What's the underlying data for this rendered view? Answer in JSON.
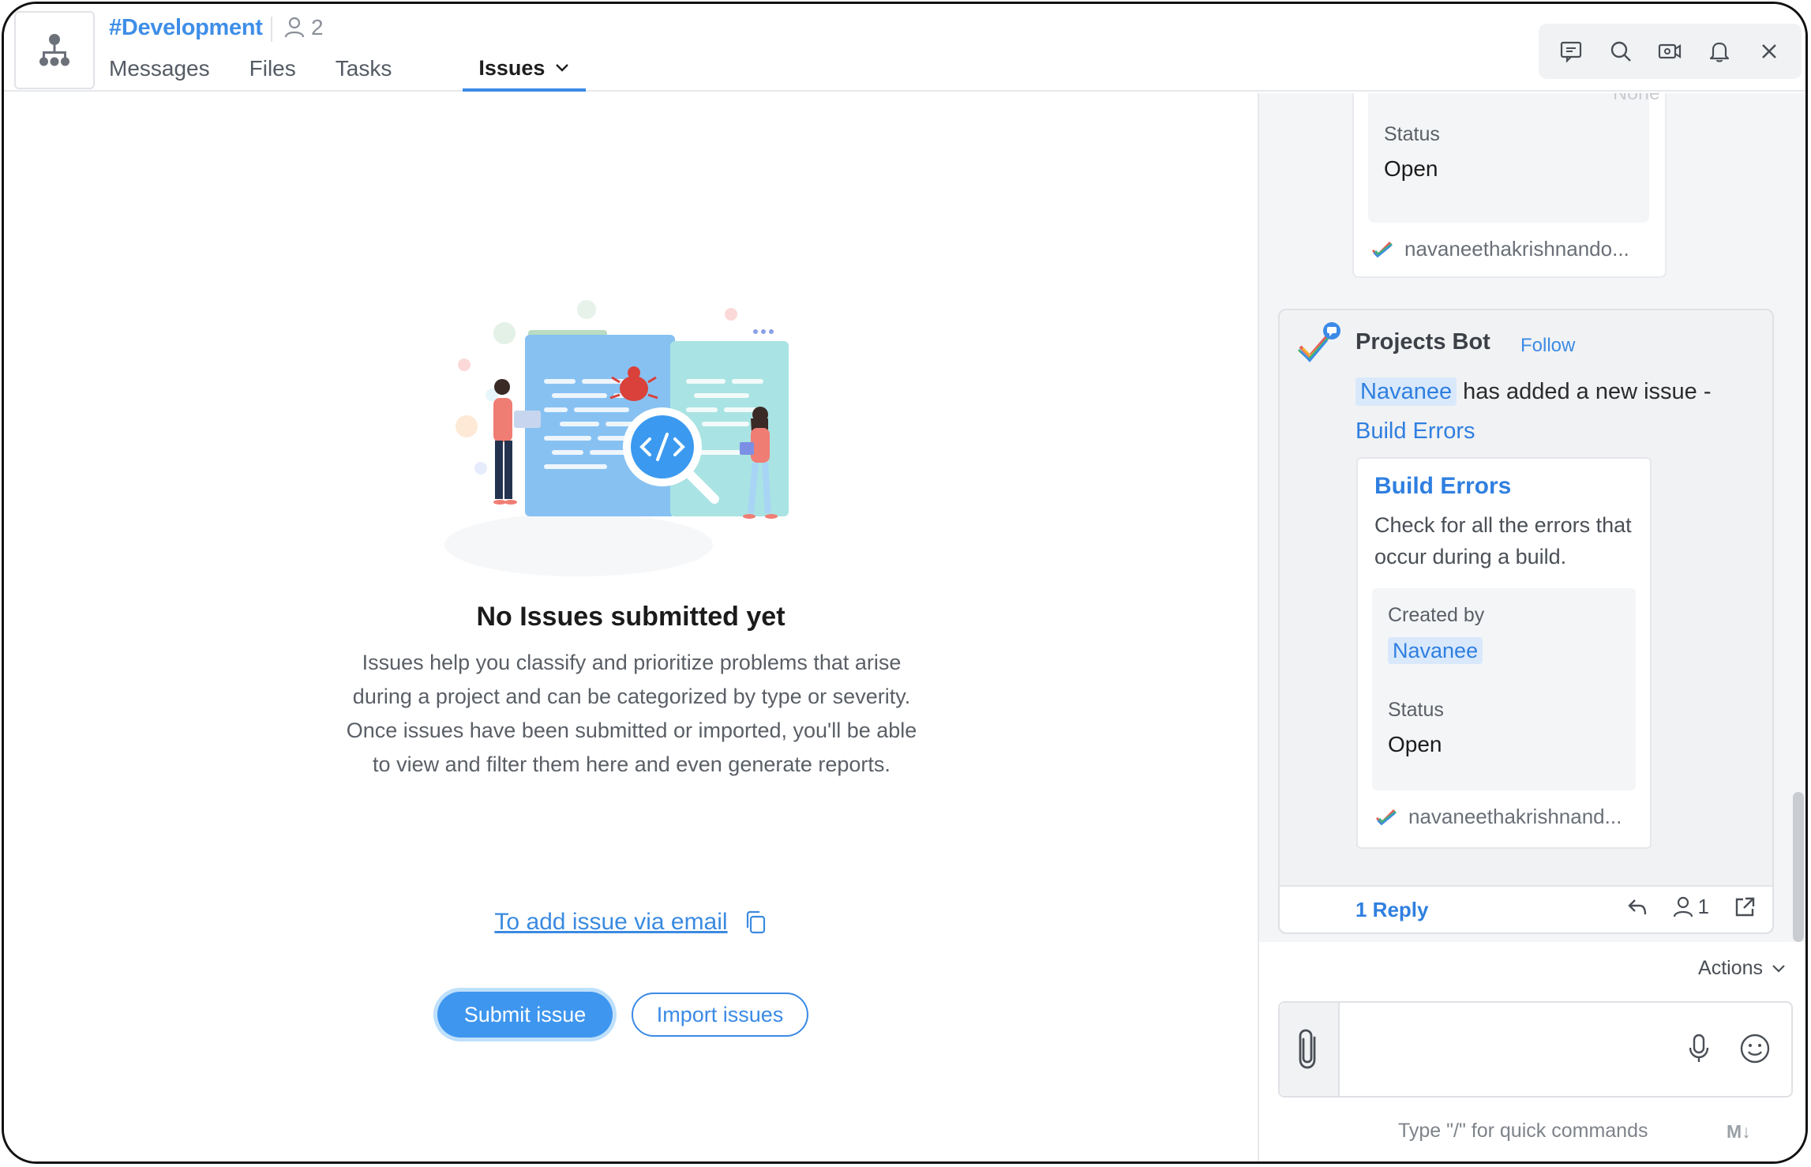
{
  "header": {
    "channel_name": "#Development",
    "member_count": "2",
    "tabs": [
      {
        "label": "Messages"
      },
      {
        "label": "Files"
      },
      {
        "label": "Tasks"
      },
      {
        "label": "Issues"
      }
    ],
    "active_tab": "Issues",
    "toolbar_icons": [
      "chat-icon",
      "search-icon",
      "video-icon",
      "bell-icon",
      "close-icon"
    ]
  },
  "empty_state": {
    "title": "No Issues submitted yet",
    "description": "Issues help you classify and prioritize problems that arise during a project and can be categorized by type or severity. Once issues have been submitted or imported, you'll be able to view and filter them here and even generate reports.",
    "email_link": "To add issue via email",
    "submit_button": "Submit issue",
    "import_button": "Import issues"
  },
  "thread": {
    "previous_card": {
      "faded_value": "None",
      "status_label": "Status",
      "status_value": "Open",
      "by": "navaneethakrishnando..."
    },
    "message": {
      "sender": "Projects Bot",
      "follow_label": "Follow",
      "mention": "Navanee",
      "text": "has added a new issue -",
      "issue_link": "Build Errors",
      "card": {
        "title": "Build Errors",
        "description": "Check for all the errors that occur during a build.",
        "created_by_label": "Created by",
        "created_by_value": "Navanee",
        "status_label": "Status",
        "status_value": "Open",
        "by": "navaneethakrishnand..."
      },
      "reply_label": "1 Reply",
      "participants": "1"
    },
    "actions_label": "Actions"
  },
  "composer": {
    "placeholder": "",
    "hint": "Type \"/\" for quick commands",
    "markdown_badge": "M↓"
  },
  "colors": {
    "accent": "#3b8ae6",
    "primary_button": "#3e96ef",
    "thread_background": "#f4f5f7"
  }
}
